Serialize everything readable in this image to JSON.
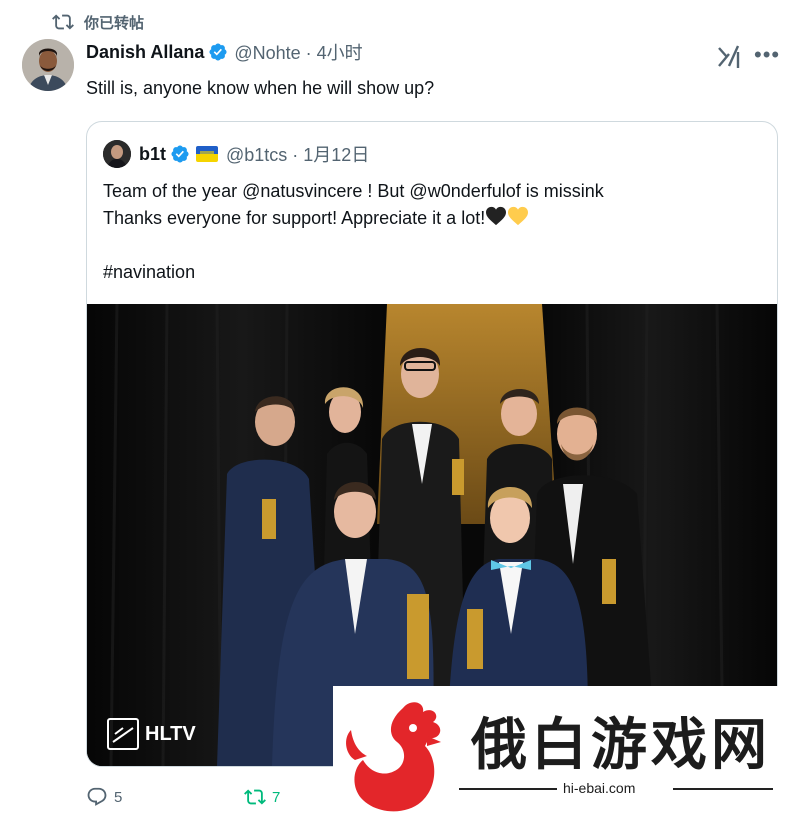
{
  "repost": {
    "label": "你已转帖"
  },
  "tweet": {
    "author_name": "Danish Allana",
    "handle_time": "@Nohte · 4小时",
    "text": "Still is, anyone know when he will show up?"
  },
  "quote": {
    "author_name": "b1t",
    "handle_time": "@b1tcs · 1月12日",
    "lines": [
      "Team of the year @natusvincere ! But @w0nderfulof is missink",
      "Thanks everyone for support! Appreciate it a lot!",
      "",
      "#navination"
    ],
    "image_logo": "HLTV"
  },
  "actions": {
    "replies": "5",
    "retweets": "7"
  },
  "watermark": {
    "title": "俄白游戏网",
    "url": "hi-ebai.com"
  },
  "colors": {
    "verified": "#1d9bf0",
    "retweet_active": "#00ba7c",
    "secondary_text": "#536471",
    "watermark_red": "#e3262a"
  },
  "icons": [
    "repost-icon",
    "verified-icon",
    "grok-icon",
    "more-icon",
    "reply-icon",
    "retweet-icon",
    "black-heart-icon",
    "yellow-heart-icon",
    "ukraine-flag-icon",
    "hltv-logo-icon",
    "rooster-logo-icon"
  ]
}
